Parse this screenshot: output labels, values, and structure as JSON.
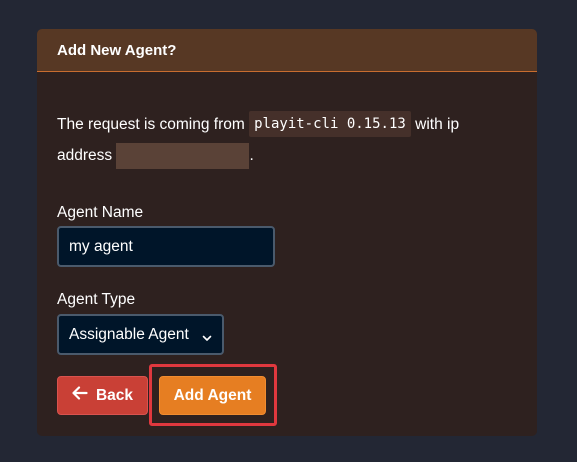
{
  "dialog": {
    "title": "Add New Agent?",
    "description_prefix": "The request is coming from",
    "client": "playit-cli 0.15.13",
    "description_middle": "with ip",
    "description_suffix": "address",
    "description_end": "."
  },
  "form": {
    "agent_name_label": "Agent Name",
    "agent_name_value": "my agent",
    "agent_type_label": "Agent Type",
    "agent_type_selected": "Assignable Agent"
  },
  "buttons": {
    "back_label": "Back",
    "add_label": "Add Agent"
  },
  "colors": {
    "page_bg": "#232734",
    "card_bg": "#2e211f",
    "header_bg": "#573824",
    "back_button": "#c94036",
    "add_button": "#e67e22",
    "highlight_border": "#e0383e"
  },
  "icons": {
    "back": "arrow-left-icon",
    "select": "chevron-down-icon"
  }
}
